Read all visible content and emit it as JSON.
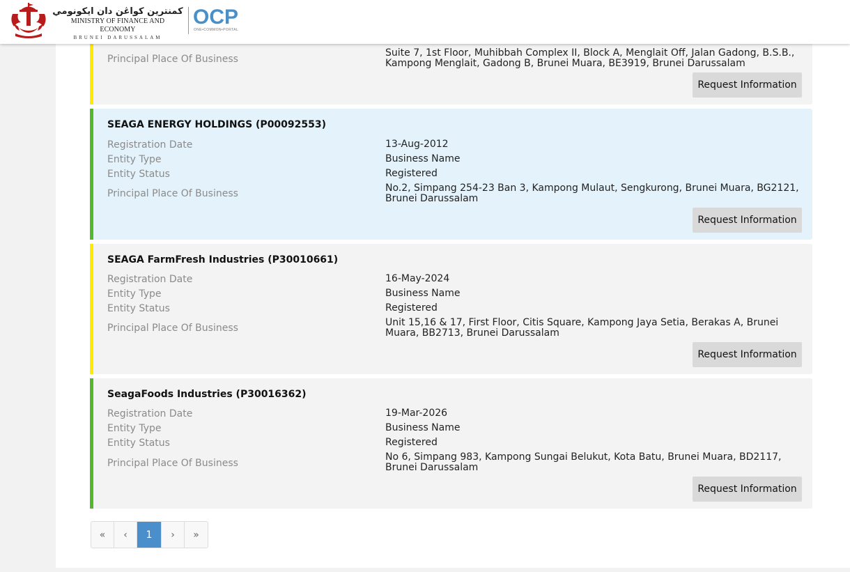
{
  "header": {
    "jawi_name": "كمنترين كواڠن دان ايكونومي",
    "ministry_name": "MINISTRY OF FINANCE AND ECONOMY",
    "country": "BRUNEI DARUSSALAM",
    "portal_logo": "OCP",
    "portal_tagline": "ONE•COMMON•PORTAL"
  },
  "labels": {
    "registration_date": "Registration Date",
    "entity_type": "Entity Type",
    "entity_status": "Entity Status",
    "principal_place": "Principal Place Of Business",
    "request_button": "Request Information"
  },
  "results": [
    {
      "title": "",
      "registration_date": "",
      "entity_type": "",
      "entity_status": "",
      "address": "Suite 7, 1st Floor, Muhibbah Complex II, Block A, Menglait Off, Jalan Gadong, B.S.B., Kampong Menglait, Gadong B, Brunei Muara, BE3919, Brunei Darussalam",
      "status_color": "#ffea00"
    },
    {
      "title": "SEAGA ENERGY HOLDINGS (P00092553)",
      "registration_date": "13-Aug-2012",
      "entity_type": "Business Name",
      "entity_status": "Registered",
      "address": "No.2, Simpang 254-23 Ban 3, Kampong Mulaut, Sengkurong, Brunei Muara, BG2121, Brunei Darussalam",
      "status_color": "#52b92a"
    },
    {
      "title": "SEAGA FarmFresh Industries (P30010661)",
      "registration_date": "16-May-2024",
      "entity_type": "Business Name",
      "entity_status": "Registered",
      "address": "Unit 15,16 & 17, First Floor, Citis Square, Kampong Jaya Setia, Berakas A, Brunei Muara, BB2713, Brunei Darussalam",
      "status_color": "#ffea00"
    },
    {
      "title": "SeagaFoods Industries (P30016362)",
      "registration_date": "19-Mar-2026",
      "entity_type": "Business Name",
      "entity_status": "Registered",
      "address": "No 6, Simpang 983, Kampong Sungai Belukut, Kota Batu, Brunei Muara, BD2117, Brunei Darussalam",
      "status_color": "#52b92a"
    }
  ],
  "pagination": {
    "first": "«",
    "prev": "‹",
    "current": "1",
    "next": "›",
    "last": "»"
  },
  "colors": {
    "accent_active_page": "#4a8fcc",
    "highlight_card": "#e4f3fb"
  }
}
